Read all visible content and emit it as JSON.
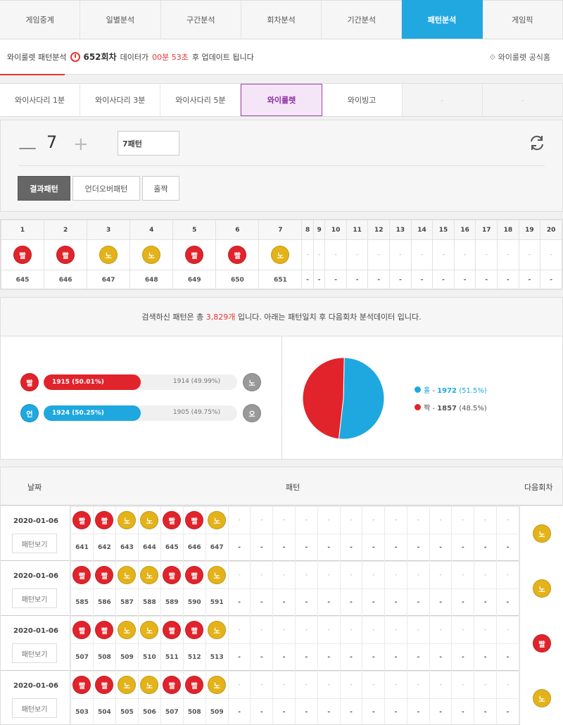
{
  "top_tabs": [
    "게임중계",
    "일별분석",
    "구간분석",
    "회차분석",
    "기간분석",
    "패턴분석",
    "게임픽"
  ],
  "info": {
    "game": "와이룰렛 패턴분석",
    "round": "652회차",
    "mid": "데이터가",
    "time": "00분 53초",
    "end": "후 업데이트 됩니다",
    "official": "와이룰렛 공식홈"
  },
  "game_tabs": [
    "와이사다리 1분",
    "와이사다리 3분",
    "와이사다리 5분",
    "와이룰렛",
    "와이빙고",
    "-",
    "-"
  ],
  "control": {
    "minus": "—",
    "count": "7",
    "plus": "+",
    "select": "7패턴",
    "buttons": [
      "결과패턴",
      "언더오버패턴",
      "홀짝"
    ]
  },
  "grid": {
    "headers": [
      "1",
      "2",
      "3",
      "4",
      "5",
      "6",
      "7",
      "8",
      "9",
      "10",
      "11",
      "12",
      "13",
      "14",
      "15",
      "16",
      "17",
      "18",
      "19",
      "20"
    ],
    "balls": [
      "빨",
      "빨",
      "노",
      "노",
      "빨",
      "빨",
      "노",
      "-",
      "-",
      "-",
      "-",
      "-",
      "-",
      "-",
      "-",
      "-",
      "-",
      "-",
      "-",
      "-"
    ],
    "rounds": [
      "645",
      "646",
      "647",
      "648",
      "649",
      "650",
      "651",
      "-",
      "-",
      "-",
      "-",
      "-",
      "-",
      "-",
      "-",
      "-",
      "-",
      "-",
      "-",
      "-"
    ]
  },
  "summary": {
    "pre": "검색하신 패턴은 총",
    "count": "3,829개",
    "post": "입니다. 아래는 패턴일치 후 다음회차 분석데이터 입니다."
  },
  "bars": [
    {
      "left_ball": "빨",
      "left_value": "1915 (50.01%)",
      "right_value": "1914 (49.99%)",
      "right_ball": "노",
      "fill_pct": 50.01,
      "color": "#e1232b"
    },
    {
      "left_ball": "언",
      "left_value": "1924 (50.25%)",
      "right_value": "1905 (49.75%)",
      "right_ball": "오",
      "fill_pct": 50.25,
      "color": "#1fa8df"
    }
  ],
  "pie": {
    "legend": [
      {
        "label": "홀",
        "value": "1972",
        "pct": "(51.5%)",
        "fraction": 0.515,
        "color": "#1fa8df"
      },
      {
        "label": "짝",
        "value": "1857",
        "pct": "(48.5%)",
        "fraction": 0.485,
        "color": "#e1232b"
      }
    ]
  },
  "history": {
    "headers": [
      "날짜",
      "패턴",
      "다음회차"
    ],
    "view_label": "패턴보기",
    "rows": [
      {
        "date": "2020-01-06",
        "balls": [
          "빨",
          "빨",
          "노",
          "노",
          "빨",
          "빨",
          "노",
          "-",
          "-",
          "-",
          "-",
          "-",
          "-",
          "-",
          "-",
          "-",
          "-",
          "-",
          "-",
          "-"
        ],
        "nums": [
          "641",
          "642",
          "643",
          "644",
          "645",
          "646",
          "647",
          "-",
          "-",
          "-",
          "-",
          "-",
          "-",
          "-",
          "-",
          "-",
          "-",
          "-",
          "-",
          "-"
        ],
        "next": "노"
      },
      {
        "date": "2020-01-06",
        "balls": [
          "빨",
          "빨",
          "노",
          "노",
          "빨",
          "빨",
          "노",
          "-",
          "-",
          "-",
          "-",
          "-",
          "-",
          "-",
          "-",
          "-",
          "-",
          "-",
          "-",
          "-"
        ],
        "nums": [
          "585",
          "586",
          "587",
          "588",
          "589",
          "590",
          "591",
          "-",
          "-",
          "-",
          "-",
          "-",
          "-",
          "-",
          "-",
          "-",
          "-",
          "-",
          "-",
          "-"
        ],
        "next": "노"
      },
      {
        "date": "2020-01-06",
        "balls": [
          "빨",
          "빨",
          "노",
          "노",
          "빨",
          "빨",
          "노",
          "-",
          "-",
          "-",
          "-",
          "-",
          "-",
          "-",
          "-",
          "-",
          "-",
          "-",
          "-",
          "-"
        ],
        "nums": [
          "507",
          "508",
          "509",
          "510",
          "511",
          "512",
          "513",
          "-",
          "-",
          "-",
          "-",
          "-",
          "-",
          "-",
          "-",
          "-",
          "-",
          "-",
          "-",
          "-"
        ],
        "next": "빨"
      },
      {
        "date": "2020-01-06",
        "balls": [
          "빨",
          "빨",
          "노",
          "노",
          "빨",
          "빨",
          "노",
          "-",
          "-",
          "-",
          "-",
          "-",
          "-",
          "-",
          "-",
          "-",
          "-",
          "-",
          "-",
          "-"
        ],
        "nums": [
          "503",
          "504",
          "505",
          "506",
          "507",
          "508",
          "509",
          "-",
          "-",
          "-",
          "-",
          "-",
          "-",
          "-",
          "-",
          "-",
          "-",
          "-",
          "-",
          "-"
        ],
        "next": "노"
      }
    ]
  }
}
